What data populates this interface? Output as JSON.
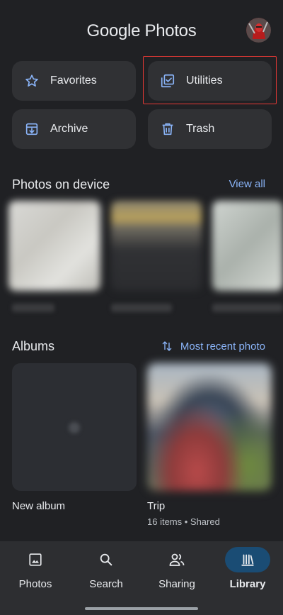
{
  "header": {
    "logo_brand": "Google",
    "logo_product": "Photos"
  },
  "quick_actions": [
    {
      "label": "Favorites",
      "icon": "star-outline-icon"
    },
    {
      "label": "Utilities",
      "icon": "utilities-check-icon"
    },
    {
      "label": "Archive",
      "icon": "archive-icon"
    },
    {
      "label": "Trash",
      "icon": "trash-icon"
    }
  ],
  "device_section": {
    "title": "Photos on device",
    "link": "View all"
  },
  "albums_section": {
    "title": "Albums",
    "sort_label": "Most recent photo",
    "albums": [
      {
        "name": "New album",
        "meta": ""
      },
      {
        "name": "Trip",
        "meta": "16 items • Shared"
      }
    ]
  },
  "bottom_nav": {
    "items": [
      {
        "label": "Photos",
        "icon": "photo-icon",
        "active": false
      },
      {
        "label": "Search",
        "icon": "search-icon",
        "active": false
      },
      {
        "label": "Sharing",
        "icon": "people-icon",
        "active": false
      },
      {
        "label": "Library",
        "icon": "library-icon",
        "active": true
      }
    ]
  },
  "colors": {
    "background": "#202124",
    "tile": "#303134",
    "accent_link": "#8ab4f8",
    "active_nav": "#1a4c74",
    "highlight": "#e53935"
  }
}
